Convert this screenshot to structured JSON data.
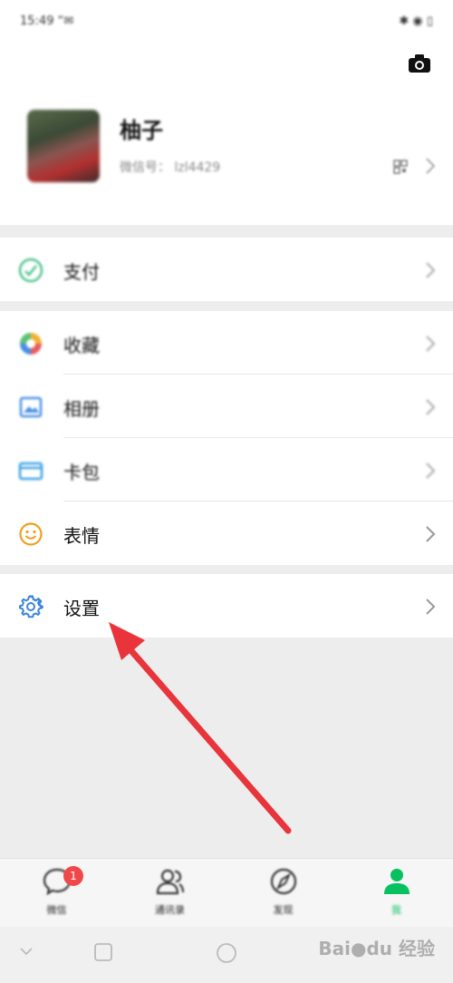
{
  "status": {
    "time": "15:49 “✉",
    "right": "✱ ◉ ▯"
  },
  "profile": {
    "nickname": "柚子",
    "wxid": "微信号： lzl4429"
  },
  "menu": {
    "pay": "支付",
    "favorites": "收藏",
    "album": "相册",
    "cards": "卡包",
    "stickers": "表情",
    "settings": "设置"
  },
  "tabs": [
    {
      "label": "微信",
      "badge": "1"
    },
    {
      "label": "通讯录"
    },
    {
      "label": "发现"
    },
    {
      "label": "我"
    }
  ],
  "watermark": "Bai●du 经验",
  "colors": {
    "accent_green": "#07c160",
    "arrow_red": "#e8343a",
    "badge_red": "#f04848"
  }
}
